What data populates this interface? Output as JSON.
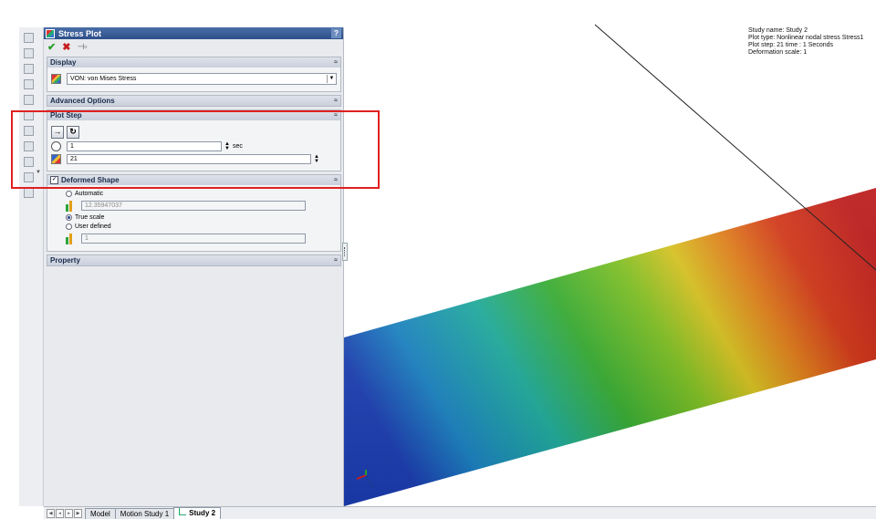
{
  "panel": {
    "title": "Stress Plot",
    "help_glyph": "?",
    "toolbar": {
      "ok_glyph": "✔",
      "cancel_glyph": "✖",
      "pin_glyph": "⊣▫"
    }
  },
  "display": {
    "header": "Display",
    "chevron": "≈",
    "component_value": "VON: von Mises Stress"
  },
  "advanced": {
    "header": "Advanced Options",
    "chevron": "≈"
  },
  "plot_step": {
    "header": "Plot Step",
    "chevron": "≈",
    "time_value": "1",
    "time_unit": "sec",
    "step_value": "21"
  },
  "deformed": {
    "header": "Deformed Shape",
    "checked": true,
    "chevron": "≈",
    "option_automatic": "Automatic",
    "automatic_value": "12.35947037",
    "option_true": "True scale",
    "option_user": "User defined",
    "user_value": "1"
  },
  "property": {
    "header": "Property",
    "chevron": "≈"
  },
  "viewport_info": {
    "line1": "Study name: Study 2",
    "line2": "Plot type: Nonlinear nodal stress Stress1",
    "line3": "Plot step: 21   time : 1 Seconds",
    "line4": "Deformation scale: 1"
  },
  "tabs": [
    {
      "label": "Model"
    },
    {
      "label": "Motion Study 1"
    },
    {
      "label": "Study 2"
    }
  ],
  "colors": {
    "accent": "#2d4f8a",
    "highlight": "#e02020"
  }
}
